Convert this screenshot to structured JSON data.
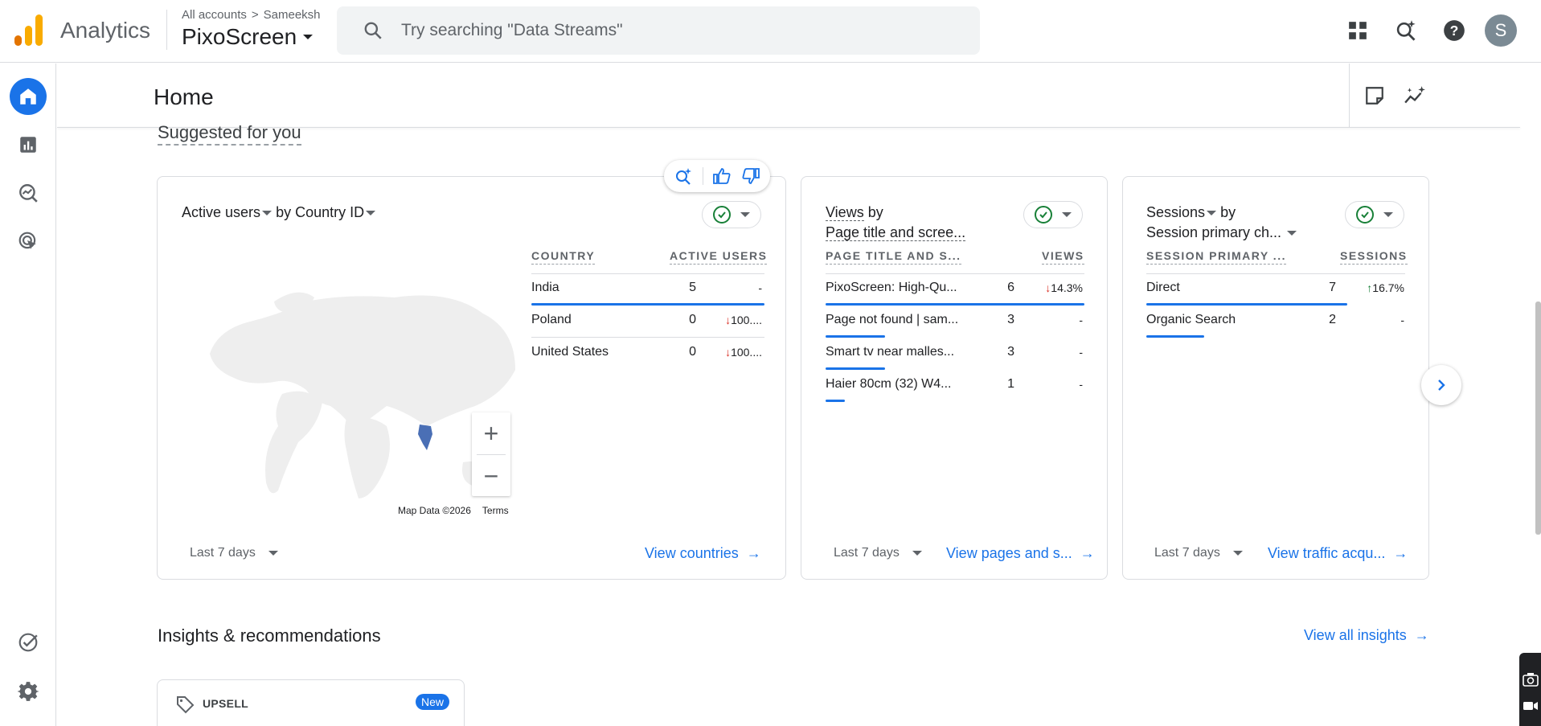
{
  "topbar": {
    "app_name": "Analytics",
    "breadcrumb_root": "All accounts",
    "breadcrumb_sep": ">",
    "breadcrumb_account": "Sameeksh",
    "property": "PixoScreen",
    "search_placeholder": "Try searching \"Data Streams\"",
    "avatar_initial": "S"
  },
  "page": {
    "title": "Home"
  },
  "suggested": {
    "heading": "Suggested for you",
    "cards": [
      {
        "metric": "Active users",
        "by": "by",
        "dimension": "Country ID",
        "col1": "COUNTRY",
        "col2": "ACTIVE USERS",
        "rows": [
          {
            "name": "India",
            "value": "5",
            "change": "-",
            "bar": 1.0
          },
          {
            "name": "Poland",
            "value": "0",
            "change": "100....",
            "dir": "down",
            "bar": 0
          },
          {
            "name": "United States",
            "value": "0",
            "change": "100....",
            "dir": "down",
            "bar": 0
          }
        ],
        "date_range": "Last 7 days",
        "link": "View countries",
        "map_credit": "Map Data ©2026",
        "map_terms": "Terms"
      },
      {
        "metric": "Views",
        "by": "by",
        "dimension": "Page title and scree...",
        "col1": "PAGE TITLE AND S...",
        "col2": "VIEWS",
        "rows": [
          {
            "name": "PixoScreen: High-Qu...",
            "value": "6",
            "change": "14.3%",
            "dir": "down",
            "bar": 1.0
          },
          {
            "name": "Page not found | sam...",
            "value": "3",
            "change": "-",
            "bar": 0.5
          },
          {
            "name": "Smart tv near malles...",
            "value": "3",
            "change": "-",
            "bar": 0.5
          },
          {
            "name": "Haier 80cm (32) W4...",
            "value": "1",
            "change": "-",
            "bar": 0.17
          }
        ],
        "date_range": "Last 7 days",
        "link": "View pages and s..."
      },
      {
        "metric": "Sessions",
        "by": "by",
        "dimension": "Session primary ch...",
        "col1": "SESSION PRIMARY ...",
        "col2": "SESSIONS",
        "rows": [
          {
            "name": "Direct",
            "value": "7",
            "change": "16.7%",
            "dir": "up",
            "bar": 1.0
          },
          {
            "name": "Organic Search",
            "value": "2",
            "change": "-",
            "bar": 0.29
          }
        ],
        "date_range": "Last 7 days",
        "link": "View traffic acqu..."
      }
    ]
  },
  "insights": {
    "title": "Insights & recommendations",
    "link": "View all insights",
    "card_label": "UPSELL",
    "badge": "New"
  },
  "colors": {
    "accent": "#1a73e8",
    "positive": "#188038",
    "negative": "#d93025",
    "map_highlight": "#4a6fb5",
    "logo_orange": "#f9ab00",
    "logo_dark_orange": "#e37400"
  },
  "icons": [
    "analytics-logo-icon",
    "search-icon",
    "apps-grid-icon",
    "search-insights-icon",
    "help-icon",
    "home-icon",
    "reports-icon",
    "explore-icon",
    "advertising-icon",
    "admin-check-icon",
    "settings-gear-icon",
    "notes-icon",
    "insights-sparkle-icon",
    "tag-icon"
  ]
}
